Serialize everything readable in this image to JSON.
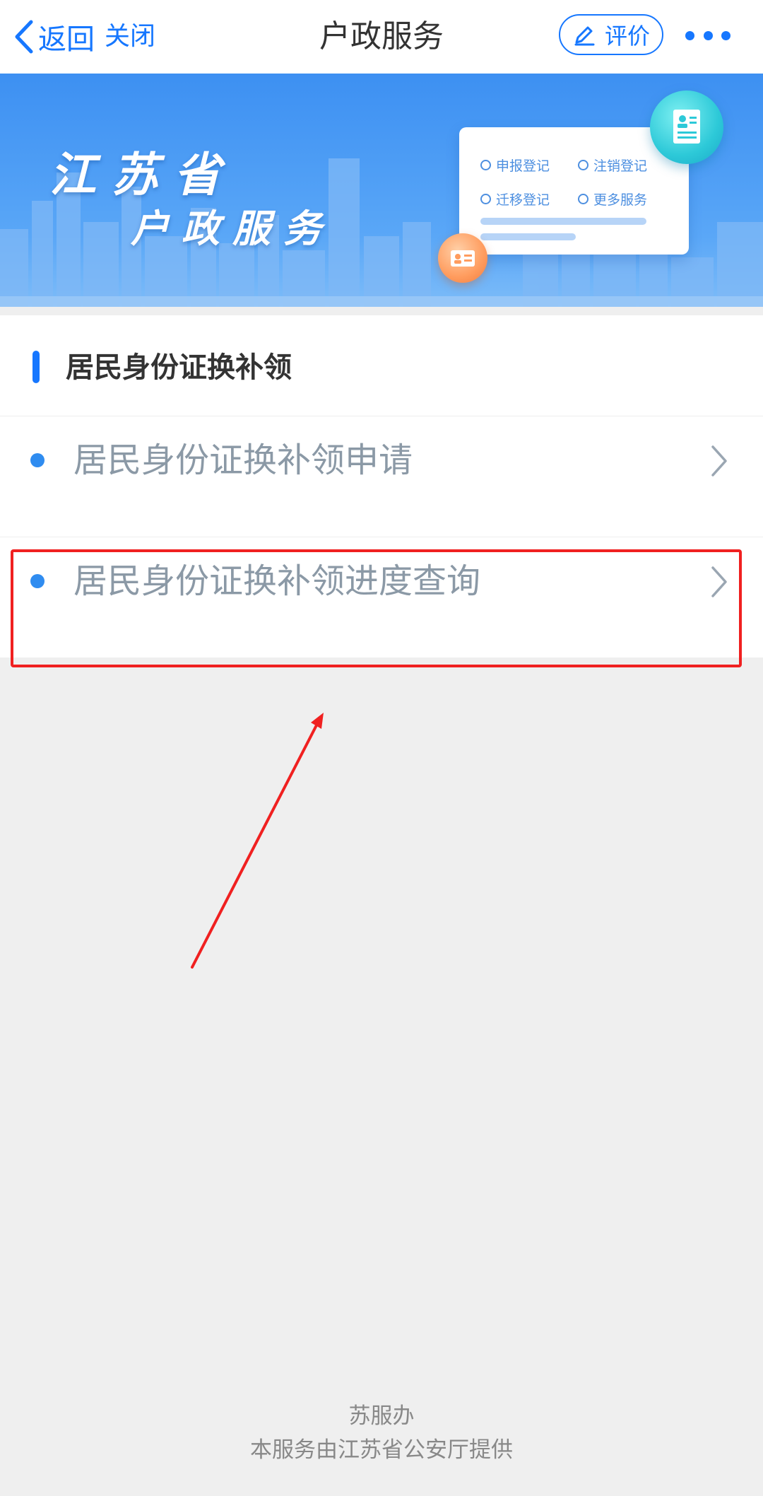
{
  "navbar": {
    "back_label": "返回",
    "close_label": "关闭",
    "title": "户政服务",
    "rate_label": "评价",
    "accent_color": "#1677ff"
  },
  "banner": {
    "title_line1": "江苏省",
    "title_line2": "户政服务",
    "card_items": [
      "申报登记",
      "注销登记",
      "迁移登记",
      "更多服务"
    ]
  },
  "section": {
    "title": "居民身份证换补领",
    "items": [
      {
        "label": "居民身份证换补领申请"
      },
      {
        "label": "居民身份证换补领进度查询"
      }
    ]
  },
  "footer": {
    "line1": "苏服办",
    "line2": "本服务由江苏省公安厅提供"
  },
  "annotation": {
    "highlight_color": "#f02020"
  }
}
